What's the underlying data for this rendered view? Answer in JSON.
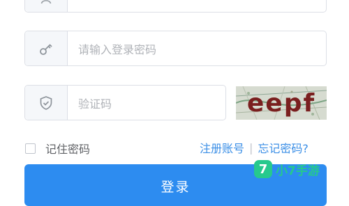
{
  "username_field": {
    "placeholder": ""
  },
  "password_field": {
    "placeholder": "请输入登录密码"
  },
  "captcha_field": {
    "placeholder": "验证码"
  },
  "captcha": {
    "text": "eepf"
  },
  "remember": {
    "label": "记住密码"
  },
  "links": {
    "register": "注册账号",
    "separator": "|",
    "forgot": "忘记密码?"
  },
  "login_button": {
    "label": "登录"
  },
  "watermark": {
    "logo": "7",
    "text": "小7手游"
  },
  "colors": {
    "accent": "#2d8cf0",
    "link": "#3a8ee6",
    "watermark": "#26c98d"
  },
  "icons": {
    "user": "user-icon",
    "password": "key-icon",
    "captcha": "shield-check-icon"
  }
}
